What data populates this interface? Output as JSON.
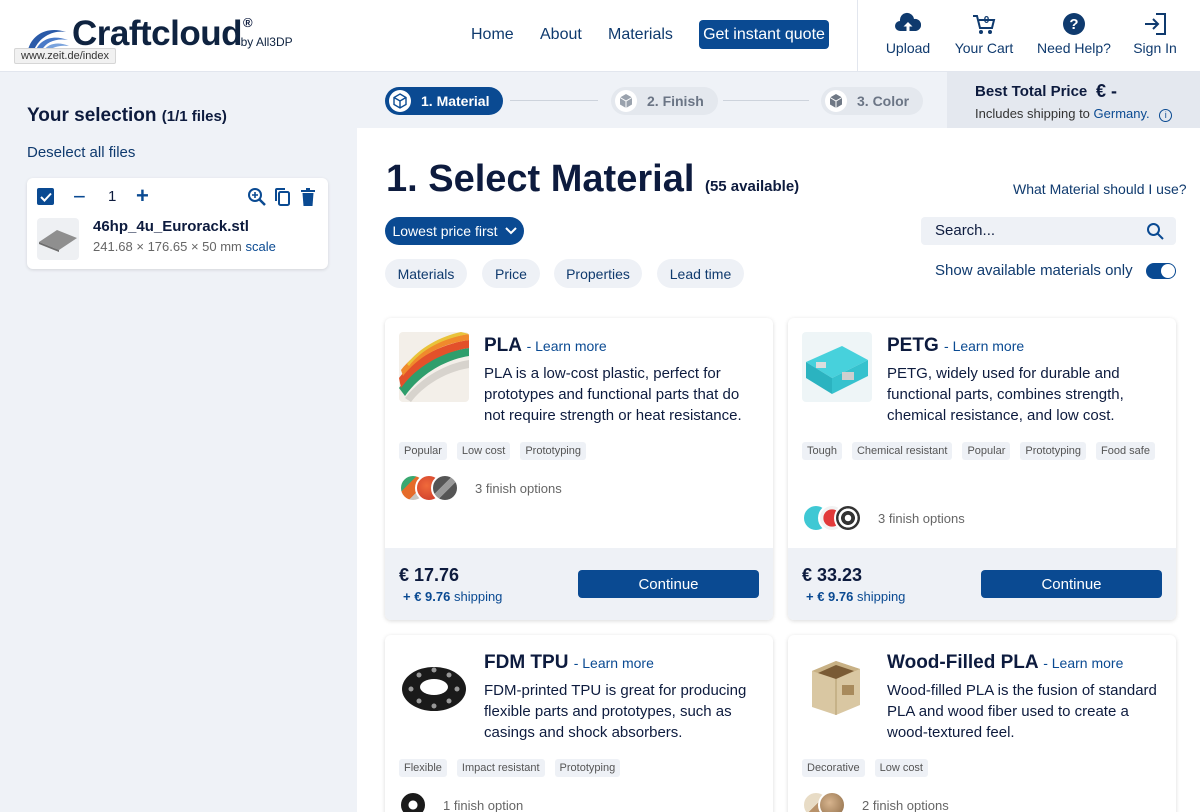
{
  "header": {
    "logo_text": "Craftcloud",
    "logo_reg": "®",
    "logo_by": "by All3DP",
    "url_tooltip": "www.zeit.de/index",
    "nav": [
      "Home",
      "About",
      "Materials"
    ],
    "quote_button": "Get instant quote",
    "actions": [
      {
        "label": "Upload",
        "icon": "upload-cloud-icon"
      },
      {
        "label": "Your Cart",
        "icon": "cart-icon",
        "badge": "0"
      },
      {
        "label": "Need Help?",
        "icon": "help-icon"
      },
      {
        "label": "Sign In",
        "icon": "sign-in-icon"
      }
    ]
  },
  "sidebar": {
    "title": "Your selection",
    "title_count": "(1/1 files)",
    "deselect": "Deselect all files",
    "file": {
      "qty": "1",
      "name": "46hp_4u_Eurorack.stl",
      "dims": "241.68 × 176.65 × 50 mm",
      "scale": "scale"
    }
  },
  "steps": [
    {
      "label": "1. Material",
      "active": true
    },
    {
      "label": "2. Finish",
      "active": false
    },
    {
      "label": "3. Color",
      "active": false
    }
  ],
  "price_box": {
    "label": "Best Total Price",
    "value": "€ -",
    "shipping_prefix": "Includes shipping to",
    "country": "Germany."
  },
  "main": {
    "title": "1. Select Material",
    "available": "(55 available)",
    "help_link": "What Material should I use?",
    "sort": "Lowest price first",
    "search_placeholder": "Search...",
    "filters": [
      "Materials",
      "Price",
      "Properties",
      "Lead time"
    ],
    "available_only": "Show available materials only"
  },
  "cards": [
    {
      "title": "PLA",
      "learn": "- Learn more",
      "desc": "PLA is a low-cost plastic, perfect for prototypes and functional parts that do not require strength or heat resistance.",
      "tags": [
        "Popular",
        "Low cost",
        "Prototyping"
      ],
      "finish": "3 finish options",
      "price": "€ 17.76",
      "shipping_amount": "+ € 9.76",
      "shipping_word": "shipping",
      "button": "Continue"
    },
    {
      "title": "PETG",
      "learn": "- Learn more",
      "desc": "PETG, widely used for durable and functional parts, combines strength, chemical resistance, and low cost.",
      "tags": [
        "Tough",
        "Chemical resistant",
        "Popular",
        "Prototyping",
        "Food safe"
      ],
      "finish": "3 finish options",
      "price": "€ 33.23",
      "shipping_amount": "+ € 9.76",
      "shipping_word": "shipping",
      "button": "Continue"
    },
    {
      "title": "FDM TPU",
      "learn": "- Learn more",
      "desc": "FDM-printed TPU is great for producing flexible parts and prototypes, such as casings and shock absorbers.",
      "tags": [
        "Flexible",
        "Impact resistant",
        "Prototyping"
      ],
      "finish": "1 finish option"
    },
    {
      "title": "Wood-Filled PLA",
      "learn": "- Learn more",
      "desc": "Wood-filled PLA is the fusion of standard PLA and wood fiber used to create a wood-textured feel.",
      "tags": [
        "Decorative",
        "Low cost"
      ],
      "finish": "2 finish options"
    }
  ],
  "colors": {
    "primary": "#0a4a92",
    "text": "#0d1b3e",
    "page_bg": "#eff2f7"
  }
}
